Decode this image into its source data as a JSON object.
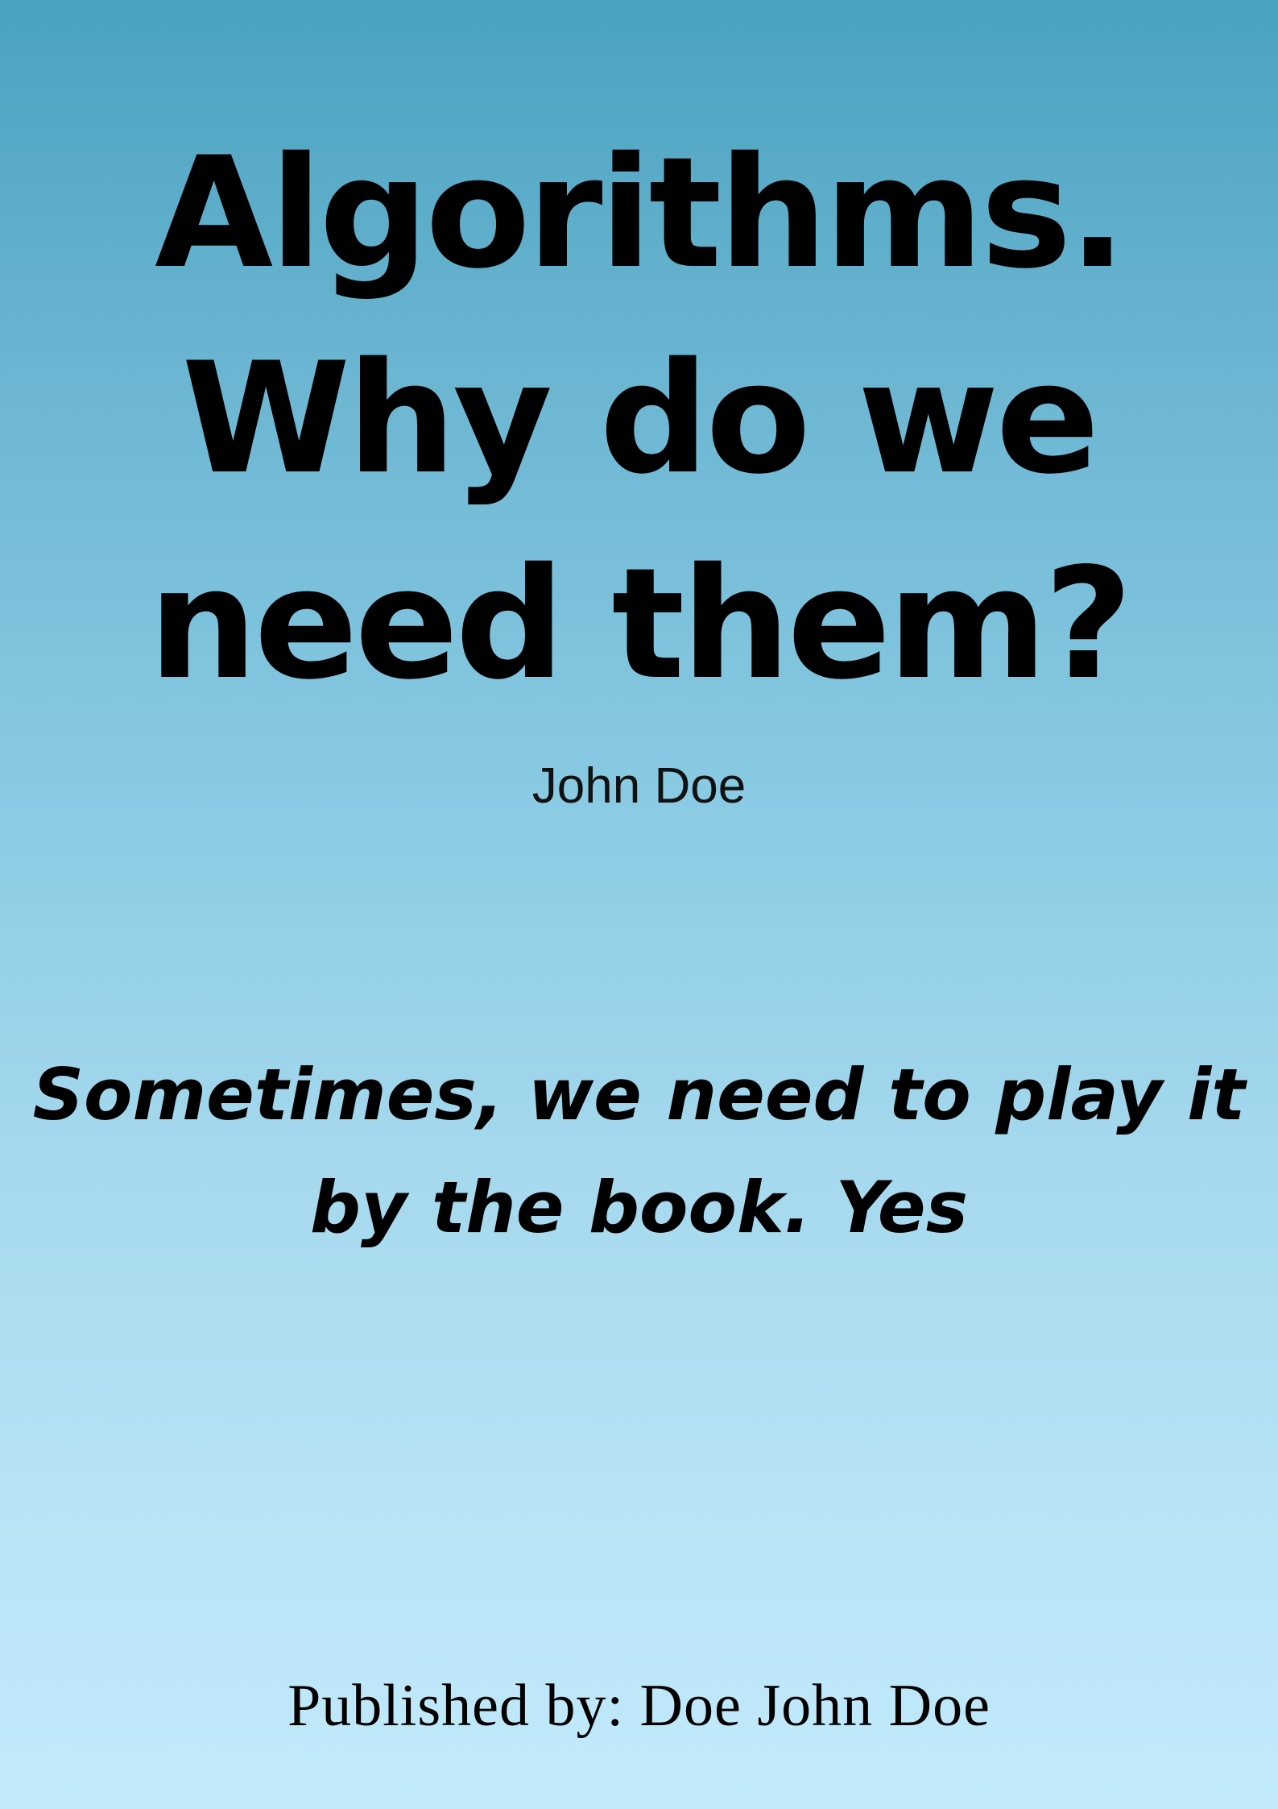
{
  "cover": {
    "title_lines": [
      "Algorithms.",
      "Why do we",
      "need them?"
    ],
    "author": "John Doe",
    "tagline_lines": [
      "Sometimes, we need to play it",
      "by the book. Yes"
    ],
    "publisher": "Published by: Doe John Doe",
    "colors": {
      "background_top": "#4aa2bf",
      "background_bottom": "#c2eafb",
      "text": "#000000"
    }
  }
}
